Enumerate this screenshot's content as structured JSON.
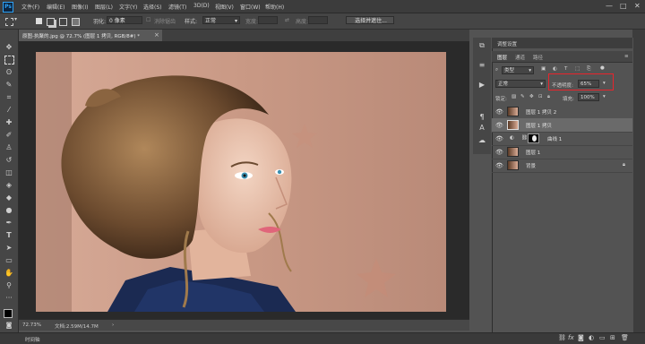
{
  "menubar": {
    "logo": "Ps",
    "items": [
      "文件(F)",
      "编辑(E)",
      "图像(I)",
      "图层(L)",
      "文字(Y)",
      "选择(S)",
      "滤镜(T)",
      "3D(D)",
      "视图(V)",
      "窗口(W)",
      "帮助(H)"
    ],
    "window_controls": [
      "—",
      "□",
      "✕"
    ]
  },
  "options": {
    "feather_label": "羽化:",
    "feather_value": "0 像素",
    "antialias": "消除锯齿",
    "style_label": "样式:",
    "style_value": "正常",
    "width_label": "宽度:",
    "height_label": "高度:",
    "select_mask_button": "选择并遮住..."
  },
  "document": {
    "tab_title": "原图-执聚的.jpg @ 72.7% (图层 1 拷贝, RGB/8#) *",
    "zoom": "72.73%",
    "doc_size": "文档:2.59M/14.7M"
  },
  "timeline": {
    "label": "时间轴"
  },
  "panel": {
    "header_title": "调整设置",
    "tabs": [
      "图层",
      "通道",
      "路径"
    ],
    "filter_kind": "类型",
    "blend_mode": "正常",
    "opacity_label": "不透明度:",
    "opacity_value": "65%",
    "lock_label": "锁定:",
    "fill_label": "填充:",
    "fill_value": "100%"
  },
  "layers": [
    {
      "name": "图层 1 拷贝 2",
      "visible": true,
      "selected": false,
      "kind": "pixel"
    },
    {
      "name": "图层 1 拷贝",
      "visible": true,
      "selected": true,
      "kind": "pixel"
    },
    {
      "name": "曲线 1",
      "visible": true,
      "selected": false,
      "kind": "adjustment"
    },
    {
      "name": "图层 1",
      "visible": true,
      "selected": false,
      "kind": "pixel"
    },
    {
      "name": "背景",
      "visible": true,
      "selected": false,
      "kind": "pixel",
      "locked": true
    }
  ],
  "colors": {
    "accent_highlight": "#e8242c",
    "ps_blue": "#2fa3f7",
    "panel_bg": "#535353",
    "canvas_bg": "#2a2a2a"
  }
}
